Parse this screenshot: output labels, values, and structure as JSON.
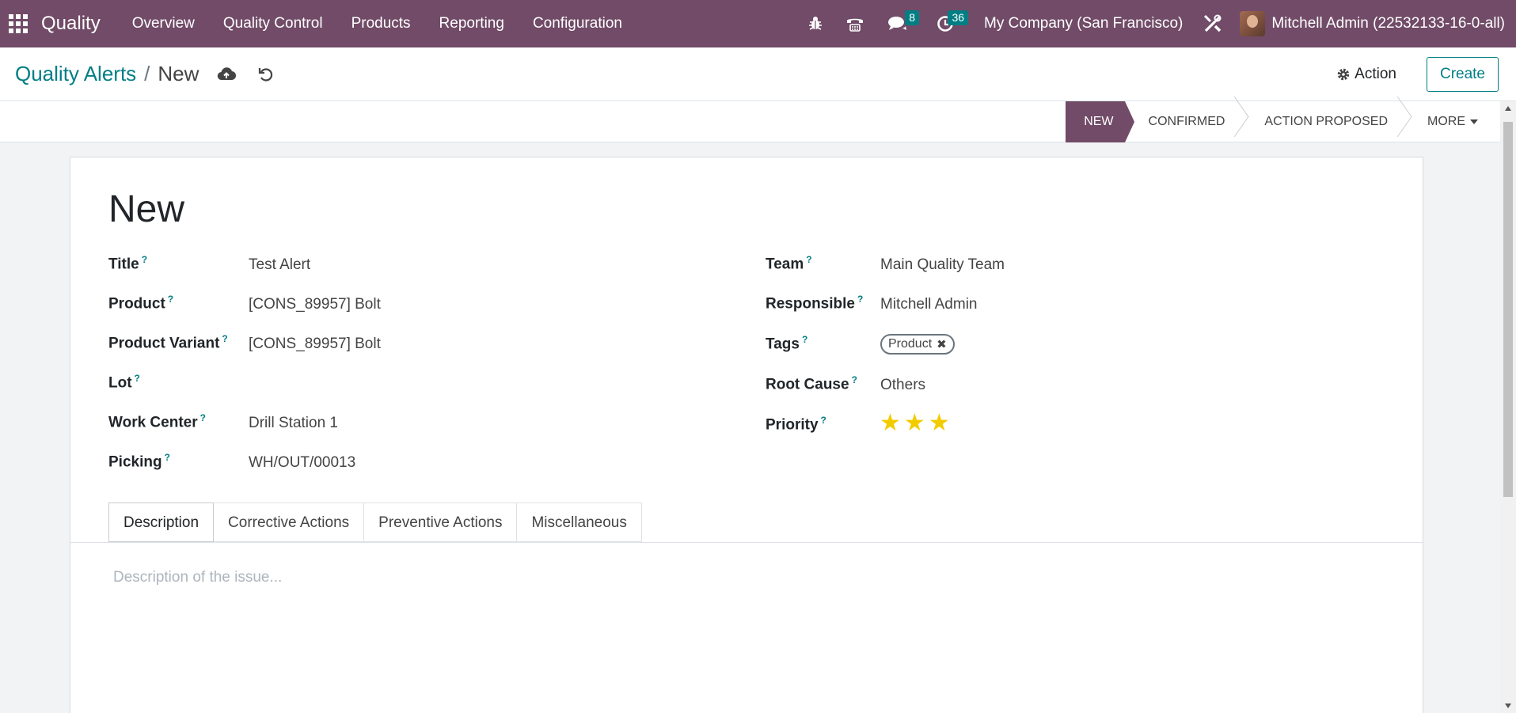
{
  "navbar": {
    "app_name": "Quality",
    "menu": [
      "Overview",
      "Quality Control",
      "Products",
      "Reporting",
      "Configuration"
    ],
    "messages_count": "8",
    "activities_count": "36",
    "company": "My Company (San Francisco)",
    "user": "Mitchell Admin (22532133-16-0-all)"
  },
  "control": {
    "breadcrumb_parent": "Quality Alerts",
    "breadcrumb_separator": "/",
    "breadcrumb_current": "New",
    "action_label": "Action",
    "create_label": "Create"
  },
  "stages": {
    "items": [
      "NEW",
      "CONFIRMED",
      "ACTION PROPOSED"
    ],
    "more_label": "MORE",
    "active_index": 0
  },
  "form": {
    "record_name": "New",
    "left_fields": [
      {
        "label": "Title",
        "value": "Test Alert"
      },
      {
        "label": "Product",
        "value": "[CONS_89957] Bolt"
      },
      {
        "label": "Product Variant",
        "value": "[CONS_89957] Bolt"
      },
      {
        "label": "Lot",
        "value": ""
      },
      {
        "label": "Work Center",
        "value": "Drill Station 1"
      },
      {
        "label": "Picking",
        "value": "WH/OUT/00013"
      }
    ],
    "right_fields": {
      "team_label": "Team",
      "team_value": "Main Quality Team",
      "responsible_label": "Responsible",
      "responsible_value": "Mitchell Admin",
      "tags_label": "Tags",
      "tag_value": "Product",
      "root_cause_label": "Root Cause",
      "root_cause_value": "Others",
      "priority_label": "Priority",
      "priority_value": 3,
      "priority_max": 3
    },
    "help_mark": "?"
  },
  "tabs": {
    "items": [
      "Description",
      "Corrective Actions",
      "Preventive Actions",
      "Miscellaneous"
    ],
    "active": "Description",
    "description_placeholder": "Description of the issue..."
  },
  "colors": {
    "brand": "#714b67",
    "accent": "#017e84",
    "star": "#f3cc00"
  }
}
